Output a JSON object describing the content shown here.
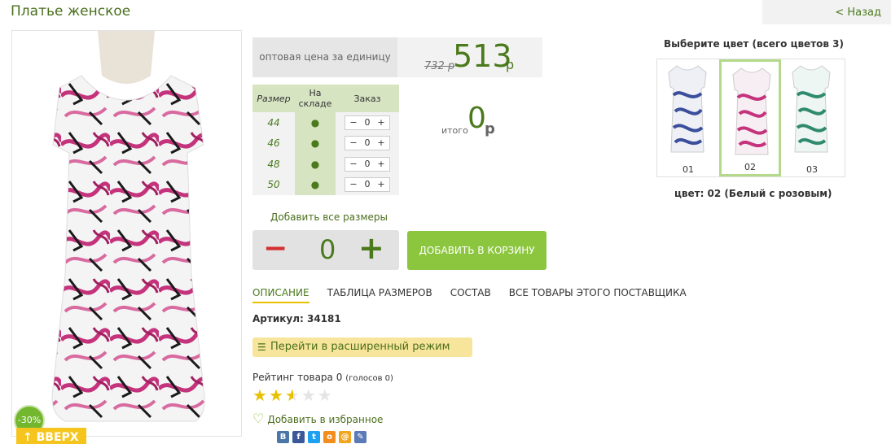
{
  "product": {
    "title": "Платье женское",
    "back_label": "< Назад",
    "discount_badge": "-30%",
    "up_button": "↑ ВВЕРХ",
    "price_label": "оптовая цена за единицу",
    "price_old": "732 р",
    "price_new": "513",
    "price_currency": "р"
  },
  "sizes": {
    "headers": [
      "Размер",
      "На складе",
      "Заказ"
    ],
    "rows": [
      {
        "size": "44",
        "stock": "●",
        "qty": "0"
      },
      {
        "size": "46",
        "stock": "●",
        "qty": "0"
      },
      {
        "size": "48",
        "stock": "●",
        "qty": "0"
      },
      {
        "size": "50",
        "stock": "●",
        "qty": "0"
      }
    ]
  },
  "total": {
    "label": "итого",
    "value": "0",
    "currency": "р"
  },
  "actions": {
    "add_all_sizes": "Добавить все размеры",
    "qty_minus": "−",
    "qty_value": "0",
    "qty_plus": "+",
    "add_to_cart": "ДОБАВИТЬ В КОРЗИНУ"
  },
  "tabs": [
    "ОПИСАНИЕ",
    "ТАБЛИЦА РАЗМЕРОВ",
    "СОСТАВ",
    "ВСЕ ТОВАРЫ ЭТОГО ПОСТАВЩИКА"
  ],
  "article": "Артикул: 34181",
  "extended_mode": "Перейти в расширенный режим",
  "rating": {
    "label": "Рейтинг товара 0",
    "votes": "(голосов 0)",
    "stars": 2.5
  },
  "favorite": "Добавить в избранное",
  "colors": {
    "title": "Выберите цвет (всего цветов 3)",
    "items": [
      {
        "label": "01",
        "accent": "#3b4e9c"
      },
      {
        "label": "02",
        "accent": "#c4337c"
      },
      {
        "label": "03",
        "accent": "#2f8a6e"
      }
    ],
    "current": "цвет: 02 (Белый с розовым)"
  },
  "social": [
    {
      "icon": "vk-icon",
      "glyph": "В",
      "color": "#4a76a8"
    },
    {
      "icon": "facebook-icon",
      "glyph": "f",
      "color": "#3b5998"
    },
    {
      "icon": "twitter-icon",
      "glyph": "t",
      "color": "#1da1f2"
    },
    {
      "icon": "odnoklassniki-icon",
      "glyph": "о",
      "color": "#f28d1e"
    },
    {
      "icon": "mailru-icon",
      "glyph": "@",
      "color": "#f2a51e"
    },
    {
      "icon": "livejournal-icon",
      "glyph": "✎",
      "color": "#5a7bb5"
    }
  ]
}
